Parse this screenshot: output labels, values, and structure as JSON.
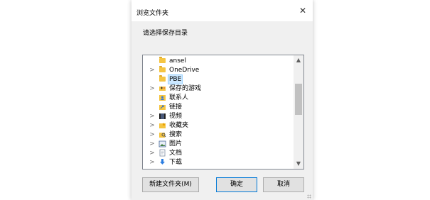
{
  "dialog": {
    "title": "浏览文件夹",
    "close_label": "✕",
    "prompt": "请选择保存目录"
  },
  "tree": {
    "items": [
      {
        "label": "ansel",
        "icon": "folder-icon",
        "expander": "",
        "selected": false
      },
      {
        "label": "OneDrive",
        "icon": "folder-icon",
        "expander": ">",
        "selected": false
      },
      {
        "label": "PBE",
        "icon": "folder-icon",
        "expander": "",
        "selected": true
      },
      {
        "label": "保存的游戏",
        "icon": "saved-games-icon",
        "expander": ">",
        "selected": false
      },
      {
        "label": "联系人",
        "icon": "contacts-icon",
        "expander": "",
        "selected": false
      },
      {
        "label": "链接",
        "icon": "links-icon",
        "expander": "",
        "selected": false
      },
      {
        "label": "视频",
        "icon": "videos-icon",
        "expander": ">",
        "selected": false
      },
      {
        "label": "收藏夹",
        "icon": "favorites-icon",
        "expander": ">",
        "selected": false
      },
      {
        "label": "搜索",
        "icon": "search-folder-icon",
        "expander": ">",
        "selected": false
      },
      {
        "label": "图片",
        "icon": "pictures-icon",
        "expander": ">",
        "selected": false
      },
      {
        "label": "文档",
        "icon": "documents-icon",
        "expander": ">",
        "selected": false
      },
      {
        "label": "下载",
        "icon": "downloads-icon",
        "expander": ">",
        "selected": false
      }
    ],
    "scroll_up": "▲",
    "scroll_down": "▼"
  },
  "buttons": {
    "new_folder": "新建文件夹(M)",
    "ok": "确定",
    "cancel": "取消"
  },
  "colors": {
    "accent": "#0078d7",
    "selection": "#cce8ff",
    "folder": "#f5c542"
  }
}
